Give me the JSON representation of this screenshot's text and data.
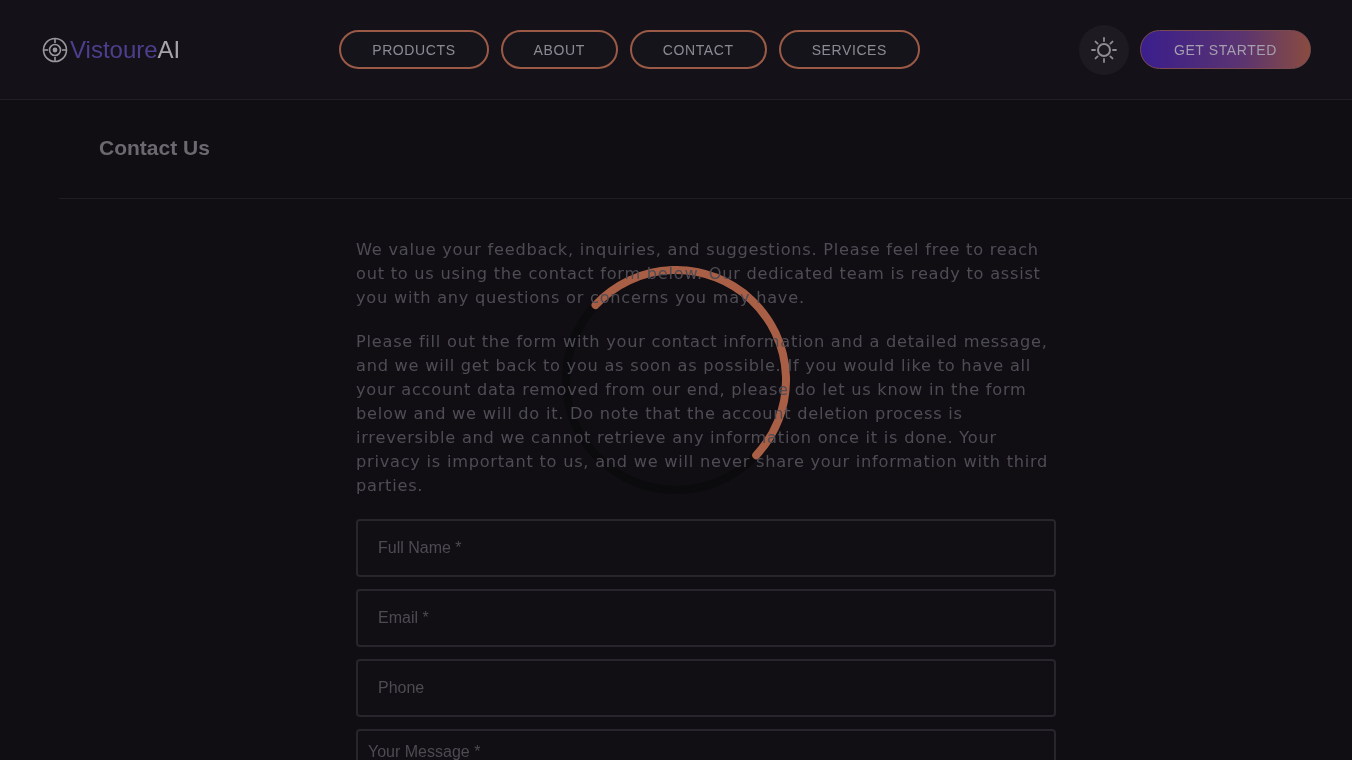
{
  "header": {
    "logo": {
      "name": "Vistoure",
      "suffix": "AI"
    },
    "nav": [
      {
        "label": "PRODUCTS"
      },
      {
        "label": "ABOUT"
      },
      {
        "label": "CONTACT"
      },
      {
        "label": "SERVICES"
      }
    ],
    "cta": "GET STARTED"
  },
  "page": {
    "title": "Contact Us"
  },
  "intro": [
    "We value your feedback, inquiries, and suggestions. Please feel free to reach out to us using the contact form below. Our dedicated team is ready to assist you with any questions or concerns you may have.",
    "Please fill out the form with your contact information and a detailed message, and we will get back to you as soon as possible. If you would like to have all your account data removed from our end, please do let us know in the form below and we will do it. Do note that the account deletion process is irreversible and we cannot retrieve any information once it is done. Your privacy is important to us, and we will never share your information with third parties."
  ],
  "form": {
    "fields": [
      {
        "kind": "input",
        "placeholder": "Full Name *"
      },
      {
        "kind": "input",
        "placeholder": "Email *"
      },
      {
        "kind": "input",
        "placeholder": "Phone"
      },
      {
        "kind": "textarea",
        "placeholder": "Your Message *"
      }
    ]
  },
  "loading": true
}
